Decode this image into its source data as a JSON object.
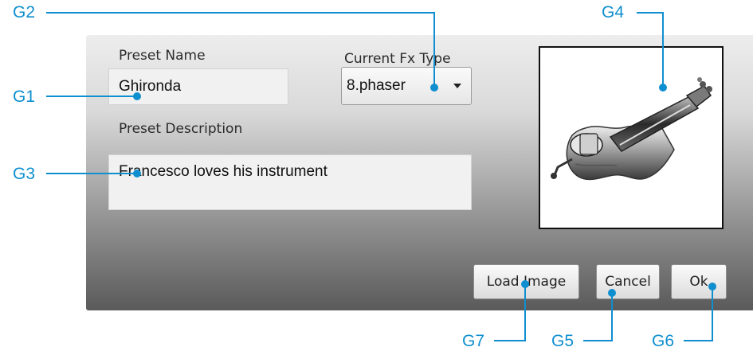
{
  "dialog": {
    "preset_name_label": "Preset Name",
    "preset_name_value": "Ghironda",
    "fx_type_label": "Current Fx Type",
    "fx_type_selected": "8.phaser",
    "preset_description_label": "Preset Description",
    "preset_description_value": "Francesco loves his instrument",
    "image_subject": "hurdy-gurdy-instrument",
    "buttons": {
      "load_image": "Load Image",
      "cancel": "Cancel",
      "ok": "Ok"
    }
  },
  "callouts": {
    "g1": "G1",
    "g2": "G2",
    "g3": "G3",
    "g4": "G4",
    "g5": "G5",
    "g6": "G6",
    "g7": "G7"
  },
  "colors": {
    "callout": "#0f8fcf",
    "dialog_top": "#ededed",
    "dialog_bottom": "#5a5a5a"
  }
}
